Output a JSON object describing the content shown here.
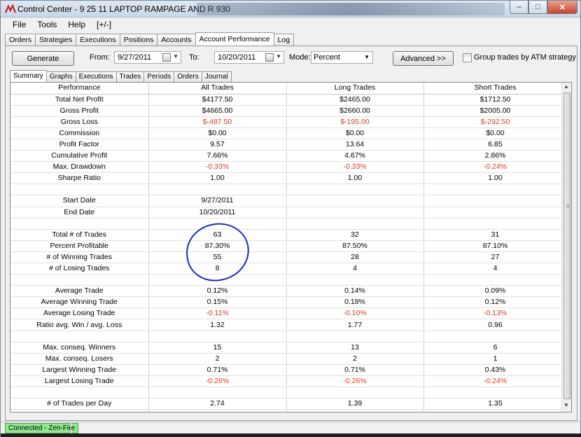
{
  "window": {
    "title": "Control Center - 9 25 11 LAPTOP RAMPAGE AND R 930",
    "min_glyph": "‒",
    "max_glyph": "□",
    "close_glyph": "✕"
  },
  "menu": [
    "File",
    "Tools",
    "Help",
    "[+/-]"
  ],
  "main_tabs": [
    "Orders",
    "Strategies",
    "Executions",
    "Positions",
    "Accounts",
    "Account Performance",
    "Log"
  ],
  "toolbar": {
    "generate_label": "Generate",
    "from_label": "From:",
    "from_value": "9/27/2011",
    "to_label": "To:",
    "to_value": "10/20/2011",
    "mode_label": "Mode:",
    "mode_value": "Percent",
    "advanced_label": "Advanced >>",
    "group_label": "Group trades by ATM strategy"
  },
  "sub_tabs": [
    "Summary",
    "Graphs",
    "Executions",
    "Trades",
    "Periods",
    "Orders",
    "Journal"
  ],
  "table": {
    "headers": [
      "Performance",
      "All Trades",
      "Long Trades",
      "Short Trades"
    ],
    "rows": [
      {
        "label": "Total Net Profit",
        "all": "$4177.50",
        "long": "$2465.00",
        "short": "$1712.50",
        "red": false
      },
      {
        "label": "Gross Profit",
        "all": "$4665.00",
        "long": "$2660.00",
        "short": "$2005.00",
        "red": false
      },
      {
        "label": "Gross Loss",
        "all": "$-487.50",
        "long": "$-195.00",
        "short": "$-292.50",
        "red": true
      },
      {
        "label": "Commission",
        "all": "$0.00",
        "long": "$0.00",
        "short": "$0.00",
        "red": false
      },
      {
        "label": "Profit Factor",
        "all": "9.57",
        "long": "13.64",
        "short": "6.85",
        "red": false
      },
      {
        "label": "Cumulative Profit",
        "all": "7.66%",
        "long": "4.67%",
        "short": "2.86%",
        "red": false
      },
      {
        "label": "Max. Drawdown",
        "all": "-0.33%",
        "long": "-0.33%",
        "short": "-0.24%",
        "red": true
      },
      {
        "label": "Sharpe Ratio",
        "all": "1.00",
        "long": "1.00",
        "short": "1.00",
        "red": false
      },
      {
        "label": "",
        "all": "",
        "long": "",
        "short": "",
        "red": false
      },
      {
        "label": "Start Date",
        "all": "9/27/2011",
        "long": "",
        "short": "",
        "red": false
      },
      {
        "label": "End Date",
        "all": "10/20/2011",
        "long": "",
        "short": "",
        "red": false
      },
      {
        "label": "",
        "all": "",
        "long": "",
        "short": "",
        "red": false
      },
      {
        "label": "Total # of Trades",
        "all": "63",
        "long": "32",
        "short": "31",
        "red": false
      },
      {
        "label": "Percent Profitable",
        "all": "87.30%",
        "long": "87.50%",
        "short": "87.10%",
        "red": false
      },
      {
        "label": "# of Winning Trades",
        "all": "55",
        "long": "28",
        "short": "27",
        "red": false
      },
      {
        "label": "# of Losing Trades",
        "all": "8",
        "long": "4",
        "short": "4",
        "red": false
      },
      {
        "label": "",
        "all": "",
        "long": "",
        "short": "",
        "red": false
      },
      {
        "label": "Average Trade",
        "all": "0.12%",
        "long": "0.14%",
        "short": "0.09%",
        "red": false
      },
      {
        "label": "Average Winning Trade",
        "all": "0.15%",
        "long": "0.18%",
        "short": "0.12%",
        "red": false
      },
      {
        "label": "Average Losing Trade",
        "all": "-0.11%",
        "long": "-0.10%",
        "short": "-0.13%",
        "red": true
      },
      {
        "label": "Ratio avg. Win / avg. Loss",
        "all": "1.32",
        "long": "1.77",
        "short": "0.96",
        "red": false
      },
      {
        "label": "",
        "all": "",
        "long": "",
        "short": "",
        "red": false
      },
      {
        "label": "Max. conseq. Winners",
        "all": "15",
        "long": "13",
        "short": "6",
        "red": false
      },
      {
        "label": "Max. conseq. Losers",
        "all": "2",
        "long": "2",
        "short": "1",
        "red": false
      },
      {
        "label": "Largest Winning Trade",
        "all": "0.71%",
        "long": "0.71%",
        "short": "0.43%",
        "red": false
      },
      {
        "label": "Largest Losing Trade",
        "all": "-0.26%",
        "long": "-0.26%",
        "short": "-0.24%",
        "red": true
      },
      {
        "label": "",
        "all": "",
        "long": "",
        "short": "",
        "red": false
      },
      {
        "label": "# of Trades per Day",
        "all": "2.74",
        "long": "1.39",
        "short": "1.35",
        "red": false
      },
      {
        "label": "",
        "all": "",
        "long": "",
        "short": "",
        "red": false
      }
    ]
  },
  "status": {
    "connection": "Connected - Zen-Fire"
  },
  "colors": {
    "loss_red": "#e03a1f",
    "annotation_blue": "#1a2cc4",
    "connected_green": "#90e890"
  }
}
